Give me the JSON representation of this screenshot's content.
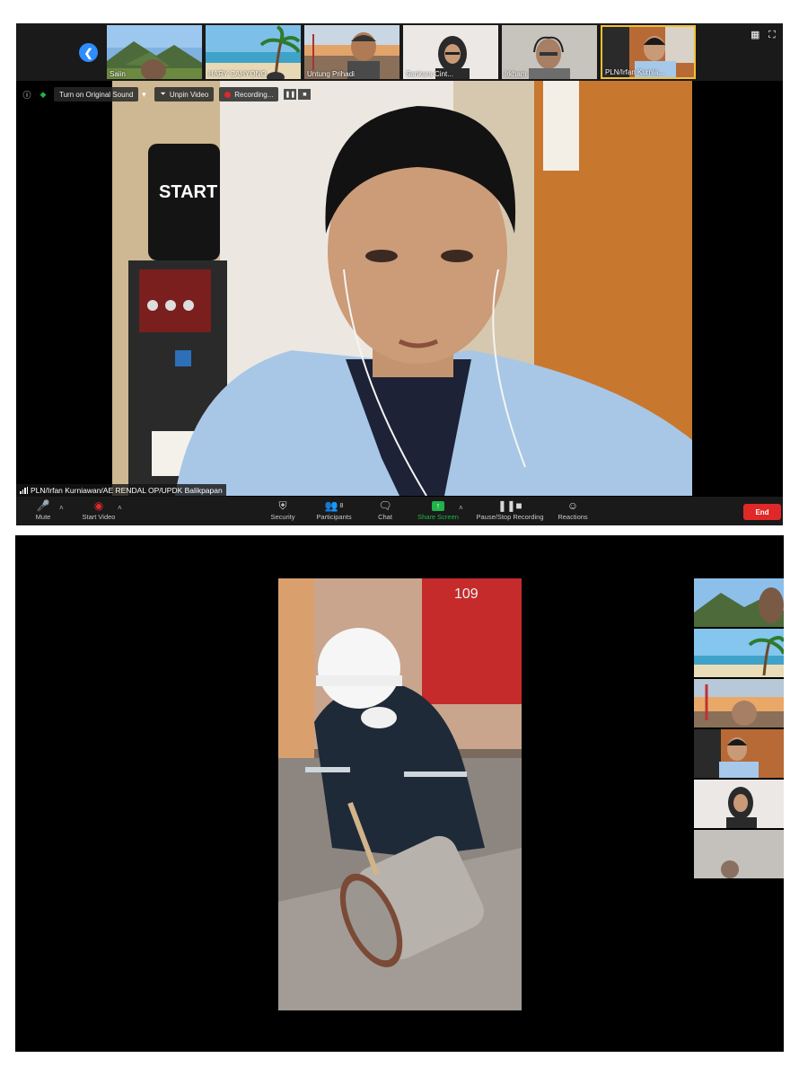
{
  "top_meeting": {
    "gallery_strip": {
      "participants": [
        {
          "name": "Saiin"
        },
        {
          "name": "HARY CAHYONO"
        },
        {
          "name": "Untung Prihadi"
        },
        {
          "name": "Sankara Cint..."
        },
        {
          "name": "Irkham"
        },
        {
          "name": "PLN/Irfan Kurnia..."
        }
      ]
    },
    "top_bar": {
      "original_sound_label": "Turn on Original Sound",
      "unpin_label": "Unpin Video",
      "recording_label": "Recording..."
    },
    "active_speaker_label": "PLN/Irfan Kurniawan/AE RENDAL OP/UPDK Balikpapan",
    "toolbar": {
      "mute_label": "Mute",
      "start_video_label": "Start Video",
      "security_label": "Security",
      "participants_label": "Participants",
      "participants_count": "8",
      "chat_label": "Chat",
      "share_screen_label": "Share Screen",
      "pause_stop_label": "Pause/Stop Recording",
      "reactions_label": "Reactions",
      "end_label": "End"
    },
    "colors": {
      "accent_blue": "#2d8cff",
      "end_red": "#e02828",
      "share_green": "#1fb34a",
      "active_border": "#f1c232"
    }
  },
  "bottom_meeting": {
    "shared_video": {
      "sign_number": "109"
    },
    "side_thumbnails": [
      "mountain-landscape",
      "beach-palm",
      "bridge-sunset",
      "man-in-office",
      "woman-hijab",
      "gray-participant"
    ]
  }
}
